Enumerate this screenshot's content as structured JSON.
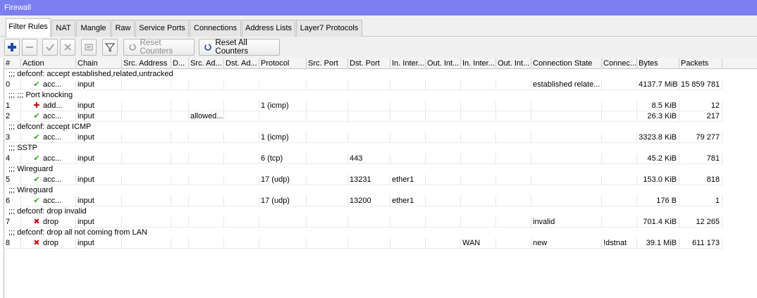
{
  "window": {
    "title": "Firewall"
  },
  "tabs": [
    "Filter Rules",
    "NAT",
    "Mangle",
    "Raw",
    "Service Ports",
    "Connections",
    "Address Lists",
    "Layer7 Protocols"
  ],
  "toolbar": {
    "add_icon": "plus-icon",
    "remove_icon": "minus-icon",
    "enable_icon": "check-icon",
    "disable_icon": "x-icon",
    "comment_icon": "comment-icon",
    "filter_icon": "filter-icon",
    "reset_counters": "Reset Counters",
    "reset_all_counters": "Reset All Counters"
  },
  "columns": [
    "#",
    "Action",
    "Chain",
    "Src. Address",
    "D...",
    "Src. Ad...",
    "Dst. Ad...",
    "Protocol",
    "Src. Port",
    "Dst. Port",
    "In. Inter...",
    "Out. Int...",
    "In. Inter...",
    "Out. Int...",
    "Connection State",
    "Connec...",
    "Bytes",
    "Packets"
  ],
  "rows": [
    {
      "type": "comment",
      "text": ";;; defconf: accept established,related,untracked"
    },
    {
      "type": "rule",
      "num": "0",
      "icon": "accept",
      "action": "acc...",
      "chain": "input",
      "src_addr": "",
      "d": "",
      "src_list": "",
      "dst_list": "",
      "protocol": "",
      "src_port": "",
      "dst_port": "",
      "in_if": "",
      "out_if": "",
      "in_if_list": "",
      "out_if_list": "",
      "conn_state": "established relate...",
      "conn_nat": "",
      "bytes": "4137.7 MiB",
      "packets": "15 859 781"
    },
    {
      "type": "comment",
      "text": ";;; ;;; Port knocking"
    },
    {
      "type": "rule",
      "num": "1",
      "icon": "add",
      "action": "add...",
      "chain": "input",
      "src_addr": "",
      "d": "",
      "src_list": "",
      "dst_list": "",
      "protocol": "1 (icmp)",
      "src_port": "",
      "dst_port": "",
      "in_if": "",
      "out_if": "",
      "in_if_list": "",
      "out_if_list": "",
      "conn_state": "",
      "conn_nat": "",
      "bytes": "8.5 KiB",
      "packets": "12"
    },
    {
      "type": "rule",
      "num": "2",
      "icon": "accept",
      "action": "acc...",
      "chain": "input",
      "src_addr": "",
      "d": "",
      "src_list": "allowed...",
      "dst_list": "",
      "protocol": "",
      "src_port": "",
      "dst_port": "",
      "in_if": "",
      "out_if": "",
      "in_if_list": "",
      "out_if_list": "",
      "conn_state": "",
      "conn_nat": "",
      "bytes": "26.3 KiB",
      "packets": "217"
    },
    {
      "type": "comment",
      "text": ";;; defconf: accept ICMP"
    },
    {
      "type": "rule",
      "num": "3",
      "icon": "accept",
      "action": "acc...",
      "chain": "input",
      "src_addr": "",
      "d": "",
      "src_list": "",
      "dst_list": "",
      "protocol": "1 (icmp)",
      "src_port": "",
      "dst_port": "",
      "in_if": "",
      "out_if": "",
      "in_if_list": "",
      "out_if_list": "",
      "conn_state": "",
      "conn_nat": "",
      "bytes": "3323.8 KiB",
      "packets": "79 277"
    },
    {
      "type": "comment",
      "text": ";;; SSTP"
    },
    {
      "type": "rule",
      "num": "4",
      "icon": "accept",
      "action": "acc...",
      "chain": "input",
      "src_addr": "",
      "d": "",
      "src_list": "",
      "dst_list": "",
      "protocol": "6 (tcp)",
      "src_port": "",
      "dst_port": "443",
      "in_if": "",
      "out_if": "",
      "in_if_list": "",
      "out_if_list": "",
      "conn_state": "",
      "conn_nat": "",
      "bytes": "45.2 KiB",
      "packets": "781"
    },
    {
      "type": "comment",
      "text": ";;; Wireguard"
    },
    {
      "type": "rule",
      "num": "5",
      "icon": "accept",
      "action": "acc...",
      "chain": "input",
      "src_addr": "",
      "d": "",
      "src_list": "",
      "dst_list": "",
      "protocol": "17 (udp)",
      "src_port": "",
      "dst_port": "13231",
      "in_if": "ether1",
      "out_if": "",
      "in_if_list": "",
      "out_if_list": "",
      "conn_state": "",
      "conn_nat": "",
      "bytes": "153.0 KiB",
      "packets": "818"
    },
    {
      "type": "comment",
      "text": ";;; Wireguard"
    },
    {
      "type": "rule",
      "num": "6",
      "icon": "accept",
      "action": "acc...",
      "chain": "input",
      "src_addr": "",
      "d": "",
      "src_list": "",
      "dst_list": "",
      "protocol": "17 (udp)",
      "src_port": "",
      "dst_port": "13200",
      "in_if": "ether1",
      "out_if": "",
      "in_if_list": "",
      "out_if_list": "",
      "conn_state": "",
      "conn_nat": "",
      "bytes": "176 B",
      "packets": "1"
    },
    {
      "type": "comment",
      "text": ";;; defconf: drop invalid"
    },
    {
      "type": "rule",
      "num": "7",
      "icon": "drop",
      "action": "drop",
      "chain": "input",
      "src_addr": "",
      "d": "",
      "src_list": "",
      "dst_list": "",
      "protocol": "",
      "src_port": "",
      "dst_port": "",
      "in_if": "",
      "out_if": "",
      "in_if_list": "",
      "out_if_list": "",
      "conn_state": "invalid",
      "conn_nat": "",
      "bytes": "701.4 KiB",
      "packets": "12 265"
    },
    {
      "type": "comment",
      "text": ";;; defconf: drop all not coming from LAN"
    },
    {
      "type": "rule",
      "num": "8",
      "icon": "drop",
      "action": "drop",
      "chain": "input",
      "src_addr": "",
      "d": "",
      "src_list": "",
      "dst_list": "",
      "protocol": "",
      "src_port": "",
      "dst_port": "",
      "in_if": "",
      "out_if": "",
      "in_if_list": "WAN",
      "out_if_list": "",
      "conn_state": "new",
      "conn_nat": "!dstnat",
      "bytes": "39.1 MiB",
      "packets": "611 173"
    }
  ]
}
